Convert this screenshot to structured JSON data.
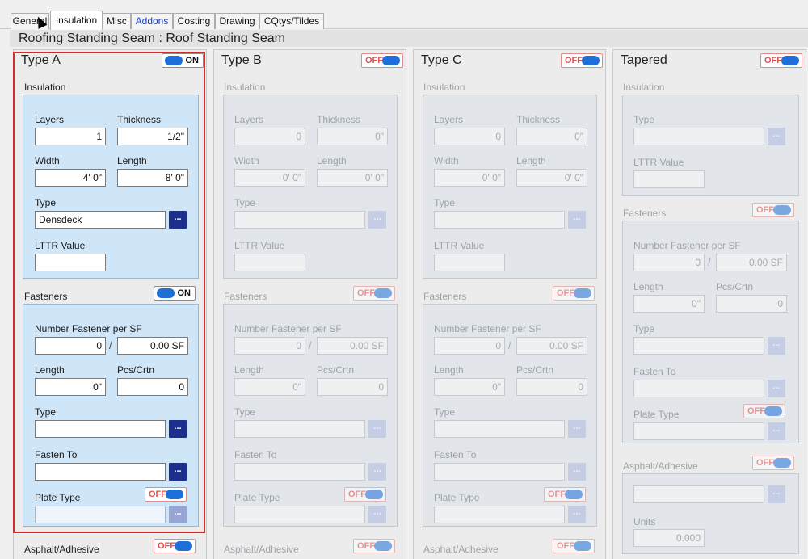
{
  "tabs": [
    "General",
    "Insulation",
    "Misc",
    "Addons",
    "Costing",
    "Drawing",
    "CQtys/Tildes"
  ],
  "page_title": "Roofing Standing Seam : Roof Standing Seam",
  "labels": {
    "insulation": "Insulation",
    "layers": "Layers",
    "thickness": "Thickness",
    "width": "Width",
    "length": "Length",
    "type": "Type",
    "lttr": "LTTR Value",
    "fasteners": "Fasteners",
    "num_fastener": "Number Fastener per SF",
    "pcs": "Pcs/Crtn",
    "fasten_to": "Fasten To",
    "plate_type": "Plate Type",
    "asphalt": "Asphalt/Adhesive",
    "units": "Units",
    "dots": "...",
    "slash": "/"
  },
  "toggles": {
    "on": "ON",
    "off": "OFF"
  },
  "typeA": {
    "title": "Type A",
    "layers": "1",
    "thickness": "1/2\"",
    "width": "4' 0\"",
    "length": "8' 0\"",
    "type": "Densdeck",
    "lttr": "",
    "num_fastener": "0",
    "per_sf": "0.00 SF",
    "f_length": "0\"",
    "pcs": "0",
    "f_type": "",
    "fasten_to": "",
    "plate_type": ""
  },
  "typeB": {
    "title": "Type B",
    "layers": "0",
    "thickness": "0\"",
    "width": "0' 0\"",
    "length": "0' 0\"",
    "num_fastener": "0",
    "per_sf": "0.00 SF",
    "f_length": "0\"",
    "pcs": "0"
  },
  "typeC": {
    "title": "Type C",
    "layers": "0",
    "thickness": "0\"",
    "width": "0' 0\"",
    "length": "0' 0\"",
    "num_fastener": "0",
    "per_sf": "0.00 SF",
    "f_length": "0\"",
    "pcs": "0"
  },
  "tapered": {
    "title": "Tapered",
    "num_fastener": "0",
    "per_sf": "0.00 SF",
    "f_length": "0\"",
    "pcs": "0",
    "units": "0.000"
  },
  "colors": {
    "highlight": "#d42a2a",
    "toggle": "#1e6fd9",
    "panel": "#cfe6f8"
  }
}
